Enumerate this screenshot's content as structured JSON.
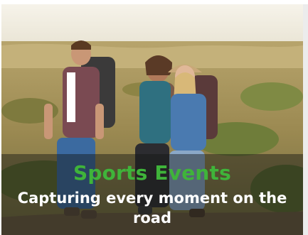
{
  "card": {
    "title": "Sports Events",
    "subtitle": "Capturing every moment on the road",
    "image": {
      "subject": "hikers-photo-icon"
    }
  },
  "colors": {
    "title": "#3fb43a",
    "subtitle": "#ffffff",
    "overlay": "rgba(20,22,20,0.45)"
  }
}
